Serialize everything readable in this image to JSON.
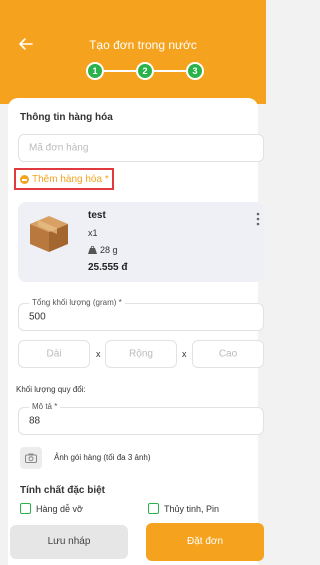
{
  "header": {
    "title": "Tạo đơn trong nước",
    "steps": [
      "1",
      "2",
      "3"
    ],
    "accent_color": "#f5a31e",
    "step_color": "#2ab34a"
  },
  "goods_section": {
    "title": "Thông tin hàng hóa",
    "order_code_placeholder": "Mã đơn hàng",
    "add_goods_label": "Thêm hàng hóa *"
  },
  "product": {
    "name": "test",
    "quantity": "x1",
    "weight": "28 g",
    "price": "25.555 đ"
  },
  "total_weight": {
    "label": "Tổng khối lượng (gram) *",
    "value": "500"
  },
  "dimensions": {
    "length_placeholder": "Dài",
    "width_placeholder": "Rộng",
    "height_placeholder": "Cao",
    "separator": "x"
  },
  "converted_weight": {
    "label": "Khối lượng quy đổi:"
  },
  "description": {
    "label": "Mô tả *",
    "value": "88"
  },
  "photo": {
    "label": "Ảnh gói hàng (tối đa 3 ảnh)"
  },
  "special": {
    "title": "Tính chất đặc biệt",
    "options": [
      "Hàng dễ vỡ",
      "Thủy tinh, Pin"
    ]
  },
  "actions": {
    "draft_label": "Lưu nháp",
    "order_label": "Đặt đơn"
  }
}
